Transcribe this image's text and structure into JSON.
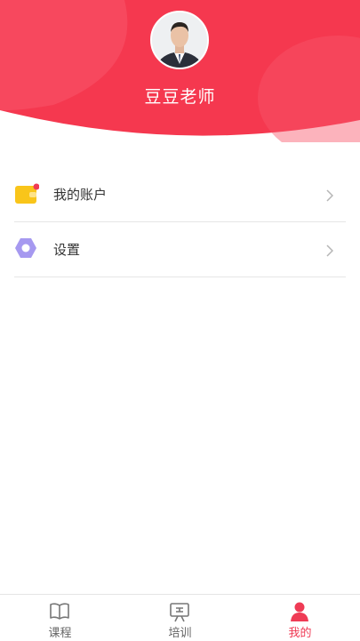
{
  "profile": {
    "name": "豆豆老师",
    "avatar_icon": "user-avatar-photo"
  },
  "menu": {
    "items": [
      {
        "label": "我的账户",
        "icon": "wallet-icon",
        "badge": "red-dot"
      },
      {
        "label": "设置",
        "icon": "hexagon-settings-icon"
      }
    ]
  },
  "tabbar": {
    "items": [
      {
        "label": "课程",
        "icon": "book-icon",
        "active": false
      },
      {
        "label": "培训",
        "icon": "presentation-icon",
        "active": false
      },
      {
        "label": "我的",
        "icon": "person-icon",
        "active": true
      }
    ]
  },
  "colors": {
    "accent": "#ef3b55",
    "header_bg": "#f5384f",
    "wallet": "#f9c51a",
    "settings": "#a699f0",
    "inactive_tab": "#666666"
  }
}
